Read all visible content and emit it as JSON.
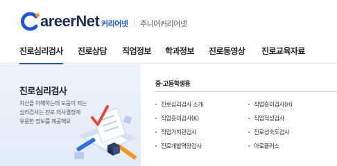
{
  "header": {
    "logo_text_c": "C",
    "logo_text_rest": "areer",
    "logo_text_net": "Net",
    "site_link_main": "커리어넷",
    "site_link_sub": "주니어커리어넷"
  },
  "nav": {
    "items": [
      {
        "label": "진로심리검사",
        "active": true
      },
      {
        "label": "진로상담",
        "active": false
      },
      {
        "label": "직업정보",
        "active": false
      },
      {
        "label": "학과정보",
        "active": false
      },
      {
        "label": "진로동영상",
        "active": false
      },
      {
        "label": "진로교육자료",
        "active": false
      }
    ],
    "active_color": "#1a56d6"
  },
  "left_panel": {
    "title": "진로심리검사",
    "desc_lines": [
      "자신을 이해하는데 도움이 되는",
      "심리검사는 진로 의사결정에",
      "유용한 정보를 제공해요"
    ]
  },
  "right_panel": {
    "heading": "중·고등학생용",
    "col1": [
      "진로심리검사 소개",
      "직업흥미검사(K)",
      "직업가치관검사",
      "진로개발역량검사"
    ],
    "col2": [
      "직업흥미검사(H)",
      "직업적성검사",
      "진로성숙도검사",
      "아로플러스"
    ]
  },
  "icons": {
    "logo": "careernet-logo-icon",
    "illustration": "checklist-illustration-icon"
  }
}
